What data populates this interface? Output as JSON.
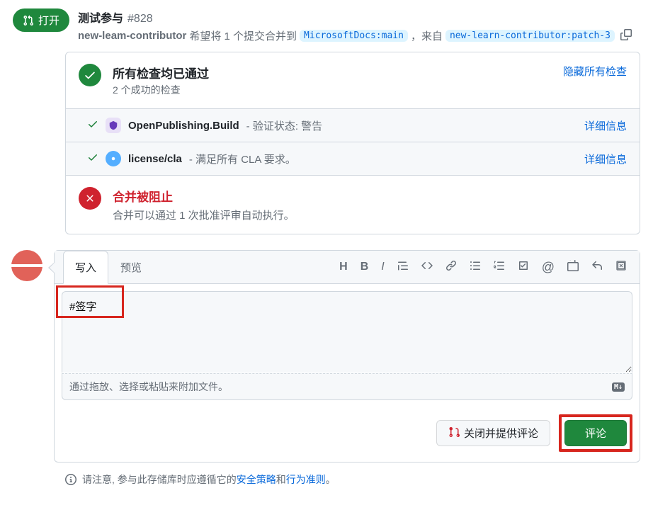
{
  "header": {
    "status_label": "打开",
    "title": "测试参与",
    "number": "#828",
    "author": "new-leam-contributor",
    "wants_merge": "希望将 1 个提交合并到",
    "base_branch": "MicrosoftDocs:main",
    "from_label": "，来自",
    "head_branch": "new-learn-contributor:patch-3"
  },
  "checks": {
    "title": "所有检查均已通过",
    "subtitle": "2 个成功的检查",
    "hide_label": "隐藏所有检查",
    "items": [
      {
        "name": "OpenPublishing.Build",
        "status": "- 验证状态: 警告",
        "detail_label": "详细信息"
      },
      {
        "name": "license/cla",
        "status": "- 满足所有 CLA 要求。",
        "detail_label": "详细信息"
      }
    ]
  },
  "merge_blocked": {
    "title": "合并被阻止",
    "subtitle": "合并可以通过 1 次批准评审自动执行。"
  },
  "comment": {
    "tab_write": "写入",
    "tab_preview": "预览",
    "textarea_value": "#签字",
    "attach_hint": "通过拖放、选择或粘贴来附加文件。",
    "md_label": "M↓"
  },
  "buttons": {
    "close": "关闭并提供评论",
    "submit": "评论"
  },
  "footer": {
    "prefix": "请注意, 参与此存储库时应遵循它的",
    "link1": "安全策略",
    "and": "和",
    "link2": "行为准则",
    "suffix": "。"
  }
}
